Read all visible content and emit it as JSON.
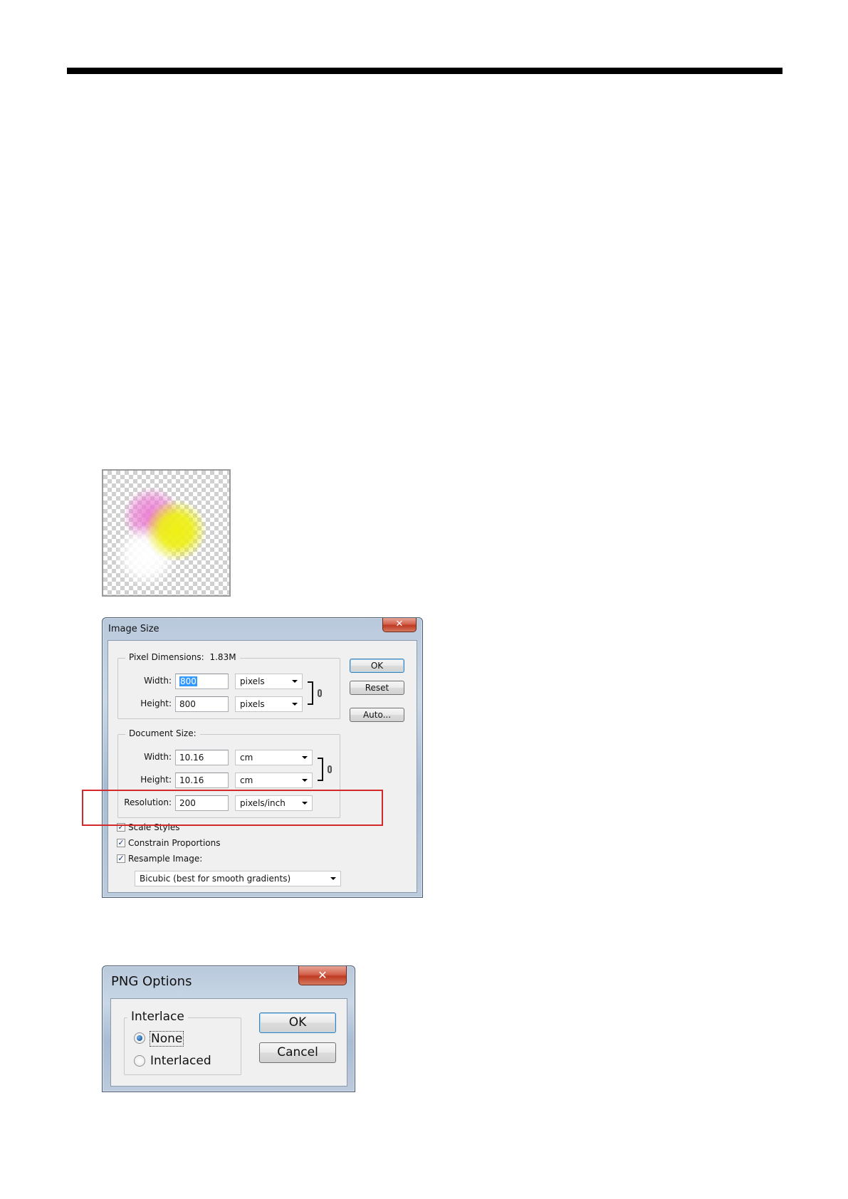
{
  "image_size_dialog": {
    "title": "Image Size",
    "close_glyph": "✕",
    "pixel_dimensions": {
      "label": "Pixel Dimensions:",
      "size": "1.83M",
      "width_label": "Width:",
      "width_value": "800",
      "width_unit": "pixels",
      "height_label": "Height:",
      "height_value": "800",
      "height_unit": "pixels"
    },
    "document_size": {
      "label": "Document Size:",
      "width_label": "Width:",
      "width_value": "10.16",
      "width_unit": "cm",
      "height_label": "Height:",
      "height_value": "10.16",
      "height_unit": "cm",
      "resolution_label": "Resolution:",
      "resolution_value": "200",
      "resolution_unit": "pixels/inch"
    },
    "buttons": {
      "ok": "OK",
      "reset": "Reset",
      "auto": "Auto..."
    },
    "checkboxes": {
      "scale_styles": {
        "label": "Scale Styles",
        "checked": true
      },
      "constrain_proportions": {
        "label": "Constrain Proportions",
        "checked": true
      },
      "resample_image": {
        "label": "Resample Image:",
        "checked": true
      }
    },
    "resample_method": "Bicubic (best for smooth gradients)",
    "highlight_color": "#d3292b"
  },
  "png_options_dialog": {
    "title": "PNG Options",
    "close_glyph": "✕",
    "group_label": "Interlace",
    "options": {
      "none": "None",
      "interlaced": "Interlaced"
    },
    "selected": "None",
    "buttons": {
      "ok": "OK",
      "cancel": "Cancel"
    }
  },
  "preview": {
    "colors": {
      "pink": "#ec78d2",
      "yellow": "#eef014",
      "white": "#ffffff"
    }
  }
}
